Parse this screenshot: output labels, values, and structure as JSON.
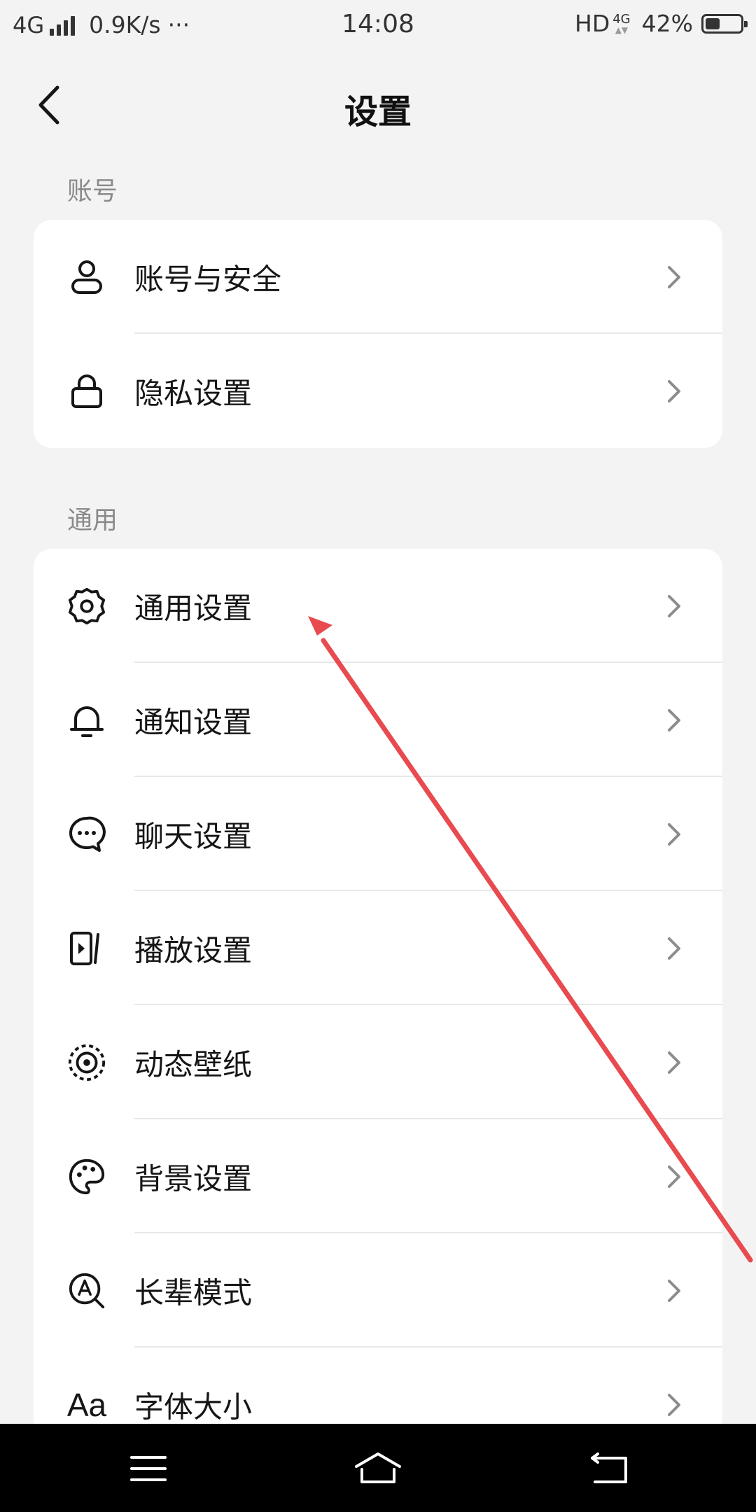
{
  "status_bar": {
    "network": "4G",
    "speed": "0.9K/s",
    "more": "···",
    "time": "14:08",
    "hd": "HD",
    "net_small": "4G",
    "battery_percent": "42%",
    "battery_level": 0.42
  },
  "header": {
    "title": "设置"
  },
  "sections": [
    {
      "label": "账号",
      "items": [
        {
          "label": "账号与安全",
          "icon": "person-icon"
        },
        {
          "label": "隐私设置",
          "icon": "lock-icon"
        }
      ]
    },
    {
      "label": "通用",
      "items": [
        {
          "label": "通用设置",
          "icon": "gear-icon"
        },
        {
          "label": "通知设置",
          "icon": "bell-icon"
        },
        {
          "label": "聊天设置",
          "icon": "chat-bubble-icon"
        },
        {
          "label": "播放设置",
          "icon": "play-screen-icon"
        },
        {
          "label": "动态壁纸",
          "icon": "dynamic-wallpaper-icon"
        },
        {
          "label": "背景设置",
          "icon": "palette-icon"
        },
        {
          "label": "长辈模式",
          "icon": "elder-mode-icon"
        },
        {
          "label": "字体大小",
          "icon": "font-size-icon",
          "icon_text": "Aa"
        }
      ]
    }
  ],
  "annotation": {
    "color": "#e84a4f"
  }
}
